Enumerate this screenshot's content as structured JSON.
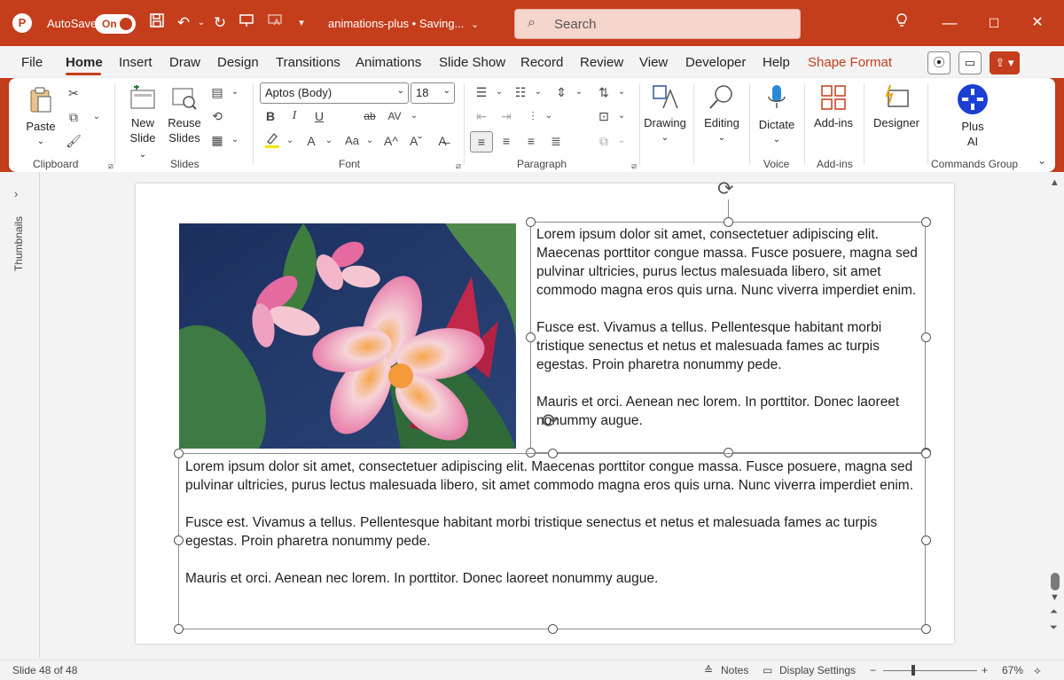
{
  "titlebar": {
    "logo": "P",
    "autosave_label": "AutoSave",
    "toggle_label": "On",
    "document_title": "animations-plus • Saving...",
    "search_placeholder": "Search",
    "icons": [
      "save-icon",
      "undo-icon",
      "redo-icon",
      "present-icon",
      "present-online-icon",
      "customize-icon",
      "lightbulb-icon",
      "minimize-icon",
      "maximize-icon",
      "close-icon"
    ]
  },
  "menu": {
    "items": [
      "File",
      "Home",
      "Insert",
      "Draw",
      "Design",
      "Transitions",
      "Animations",
      "Slide Show",
      "Record",
      "Review",
      "View",
      "Developer",
      "Help",
      "Shape Format"
    ],
    "active": "Home"
  },
  "ribbon": {
    "clipboard": {
      "label": "Clipboard",
      "paste": "Paste"
    },
    "slides": {
      "label": "Slides",
      "new_slide_1": "New",
      "new_slide_2": "Slide",
      "reuse_1": "Reuse",
      "reuse_2": "Slides"
    },
    "font": {
      "label": "Font",
      "font_name": "Aptos (Body)",
      "font_size": "18",
      "bold": "B",
      "italic": "I",
      "underline": "U",
      "strike": "ab",
      "spacing": "AV",
      "color": "A",
      "case": "Aa",
      "grow": "A^",
      "shrink": "Aˇ"
    },
    "paragraph": {
      "label": "Paragraph"
    },
    "drawing": {
      "label": "Drawing"
    },
    "editing": {
      "label": "Editing"
    },
    "voice": {
      "label": "Voice",
      "dictate": "Dictate"
    },
    "addins": {
      "label": "Add-ins",
      "button": "Add-ins"
    },
    "designer": {
      "label": "Designer"
    },
    "commands": {
      "label": "Commands Group",
      "plus_1": "Plus",
      "plus_2": "AI"
    }
  },
  "sidebar": {
    "thumbnails_label": "Thumbnails"
  },
  "slide": {
    "right_box": {
      "p1": "Lorem ipsum dolor sit amet, consectetuer adipiscing elit. Maecenas porttitor congue massa. Fusce posuere, magna sed pulvinar ultricies, purus lectus malesuada libero, sit amet commodo magna eros quis urna. Nunc viverra imperdiet enim.",
      "p2": "Fusce est. Vivamus a tellus. Pellentesque habitant morbi tristique senectus et netus et malesuada fames ac turpis egestas. Proin pharetra nonummy pede.",
      "p3": "Mauris et orci. Aenean nec lorem. In porttitor. Donec laoreet nonummy augue."
    },
    "bottom_box": {
      "p1": "Lorem ipsum dolor sit amet, consectetuer adipiscing elit. Maecenas porttitor congue massa. Fusce posuere, magna sed pulvinar ultricies, purus lectus malesuada libero, sit amet commodo magna eros quis urna. Nunc viverra imperdiet enim.",
      "p2": "Fusce est. Vivamus a tellus. Pellentesque habitant morbi tristique senectus et netus et malesuada fames ac turpis egestas. Proin pharetra nonummy pede.",
      "p3": "Mauris et orci. Aenean nec lorem. In porttitor. Donec laoreet nonummy augue."
    }
  },
  "statusbar": {
    "slide_info": "Slide 48 of 48",
    "notes": "Notes",
    "display_settings": "Display Settings",
    "zoom_minus": "−",
    "zoom_plus": "+",
    "zoom": "67%"
  },
  "colors": {
    "accent": "#c43e1c",
    "ribbon_bg": "#ffffff",
    "workspace_bg": "#f3f3f3"
  }
}
